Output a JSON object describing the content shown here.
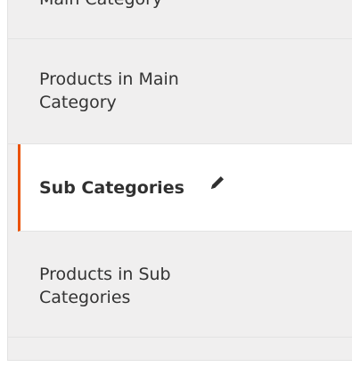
{
  "nav": {
    "items": [
      {
        "label": "Main Category"
      },
      {
        "label": "Products in Main Category"
      },
      {
        "label": "Sub Categories",
        "active": true
      },
      {
        "label": "Products in Sub Categories"
      }
    ]
  },
  "colors": {
    "active_accent": "#eb5202",
    "panel_bg": "#f0efef",
    "active_bg": "#ffffff",
    "text": "#333333"
  },
  "icons": {
    "edit": "pencil-icon"
  }
}
